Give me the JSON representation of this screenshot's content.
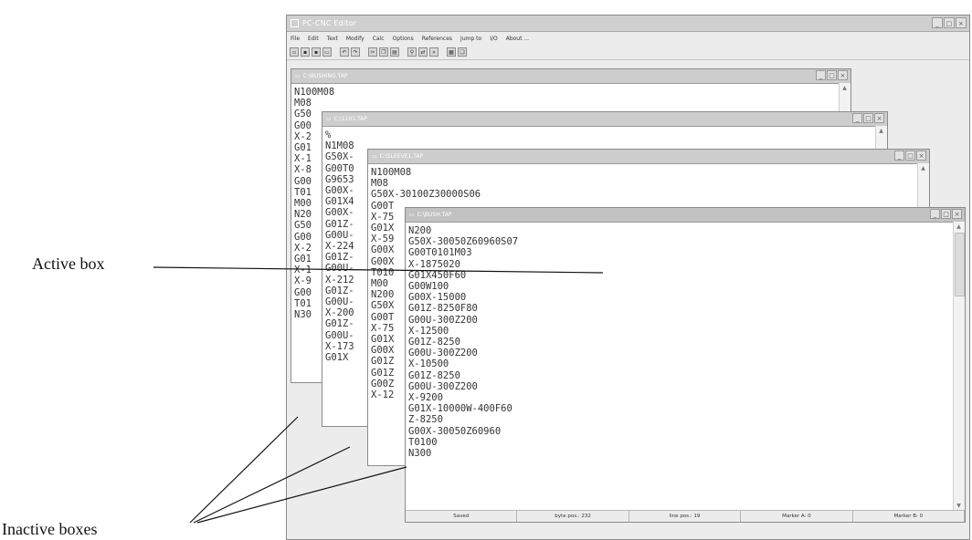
{
  "app": {
    "title": "PC-CNC Editor",
    "menu": [
      "File",
      "Edit",
      "Text",
      "Modify",
      "Calc",
      "Options",
      "References",
      "Jump to",
      "I/O",
      "About ..."
    ],
    "toolbar_icons": [
      "new-file-icon",
      "open-file-icon",
      "save-file-icon",
      "print-icon",
      "undo-icon",
      "redo-icon",
      "cut-icon",
      "copy-icon",
      "paste-icon",
      "find-icon",
      "replace-icon",
      "find-next-icon",
      "tile-icon",
      "cascade-icon"
    ]
  },
  "windows": [
    {
      "title": "C:\\BUSHING.TAP",
      "lines": [
        "N100M08",
        "M08",
        "G50",
        "G00",
        "X-2",
        "G01",
        "X-1",
        "X-8",
        "G00",
        "T01",
        "M00",
        "N20",
        "G50",
        "G00",
        "X-2",
        "G01",
        "X-1",
        "X-9",
        "G00",
        "T01",
        "N30"
      ]
    },
    {
      "title": "C:\\1101.TAP",
      "lines": [
        "%",
        "N1M08",
        "G50X-",
        "G00T0",
        "G9653",
        "G00X-",
        "G01X4",
        "G00X-",
        "G01Z-",
        "G00U-",
        "X-224",
        "G01Z-",
        "G00U-",
        "X-212",
        "G01Z-",
        "G00U-",
        "X-200",
        "G01Z-",
        "G00U-",
        "X-173",
        "G01X"
      ]
    },
    {
      "title": "C:\\SLEEVE1.TAP",
      "lines": [
        "N100M08",
        "M08",
        "G50X-30100Z30000S06",
        "G00T",
        "X-75",
        "G01X",
        "X-59",
        "G00X",
        "G00X",
        "T010",
        "M00",
        "N200",
        "G50X",
        "G00T",
        "X-75",
        "G01X",
        "G00X",
        "G01Z",
        "G01Z",
        "G00Z",
        "X-12"
      ]
    },
    {
      "title": "C:\\BUSH.TAP",
      "lines": [
        "N200",
        "G50X-30050Z60960S07",
        "G00T0101M03",
        "X-1875020",
        "G01X450F60",
        "G00W100",
        "G00X-15000",
        "G01Z-8250F80",
        "G00U-300Z200",
        "X-12500",
        "G01Z-8250",
        "G00U-300Z200",
        "X-10500",
        "G01Z-8250",
        "G00U-300Z200",
        "X-9200",
        "G01X-10000W-400F60",
        "Z-8250",
        "G00X-30050Z60960",
        "T0100",
        "N300"
      ],
      "status": [
        "Saved",
        "byte pos.: 232",
        "line pos.: 19",
        "Marker A: 0",
        "Marker B: 0"
      ]
    }
  ],
  "annotations": {
    "active": "Active box",
    "inactive": "Inactive boxes"
  }
}
